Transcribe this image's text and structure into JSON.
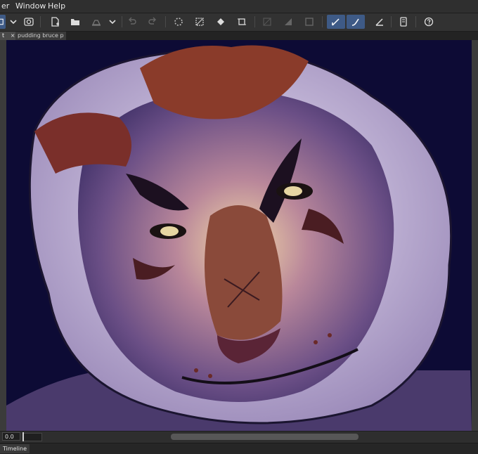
{
  "menu": {
    "partial_item": "er",
    "window": "Window",
    "help": "Help"
  },
  "toolbar": {
    "icons": [
      "panel-toggle-icon",
      "chevron-down-icon",
      "camera-icon",
      "new-file-icon",
      "open-folder-icon",
      "save-icon",
      "chevron-down-icon",
      "undo-icon",
      "redo-icon",
      "loading-icon",
      "clear-icon",
      "fill-icon",
      "crop-icon",
      "transparent-icon",
      "gradient-icon",
      "border-icon",
      "pen-tool-icon",
      "brush-tool-icon",
      "line-tool-icon",
      "device-icon",
      "help-icon"
    ]
  },
  "tabs": [
    {
      "label": "t",
      "close": "×"
    },
    {
      "label": "pudding bruce p",
      "close": "●"
    }
  ],
  "bottom": {
    "zoom_value": "0.0"
  },
  "status": {
    "timeline_label": "Timeline"
  },
  "colors": {
    "canvas_bg": "#0d0b35",
    "accent": "#3e5a86"
  }
}
